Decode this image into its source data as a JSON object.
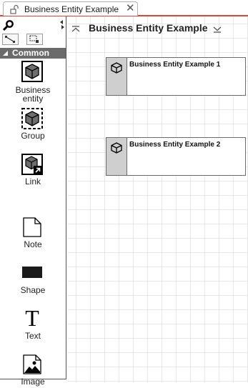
{
  "tab": {
    "title": "Business Entity Example"
  },
  "toolbox": {
    "section": "Common",
    "tools": [
      {
        "label": "Business entity",
        "line1": "Business",
        "line2": "entity",
        "icon": "business-entity-icon"
      },
      {
        "label": "Group",
        "icon": "group-icon"
      },
      {
        "label": "Link",
        "icon": "link-icon"
      },
      {
        "label": "Note",
        "icon": "note-icon"
      },
      {
        "label": "Shape",
        "icon": "shape-icon"
      },
      {
        "label": "Text",
        "icon": "text-icon"
      },
      {
        "label": "Image",
        "icon": "image-icon"
      }
    ]
  },
  "diagram": {
    "title": "Business Entity Example",
    "entities": [
      {
        "name": "Business Entity Example 1"
      },
      {
        "name": "Business Entity Example 2"
      }
    ]
  },
  "colors": {
    "tab_accent": "#e34234",
    "section_header": "#6b6b6b",
    "entity_band": "#cfcfcf"
  }
}
